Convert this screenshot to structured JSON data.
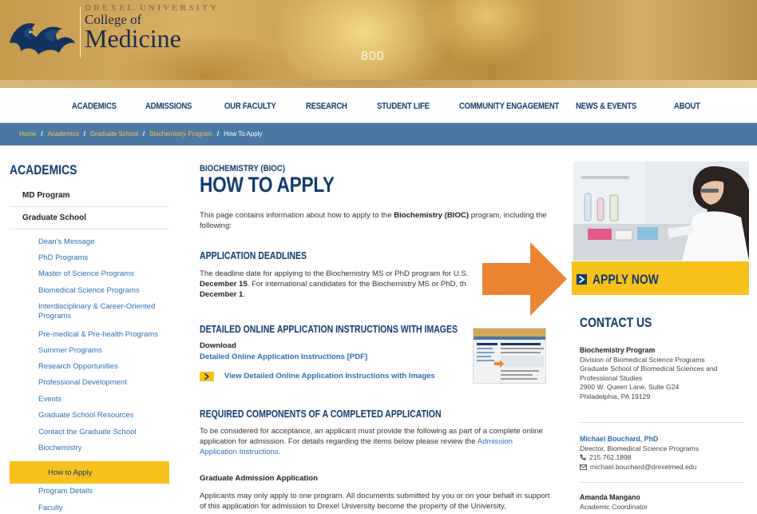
{
  "header": {
    "university": "DREXEL UNIVERSITY",
    "college_line1": "College of",
    "college_line2": "Medicine",
    "banner_mark": "800"
  },
  "nav": {
    "items": [
      "ACADEMICS",
      "ADMISSIONS",
      "OUR FACULTY",
      "RESEARCH",
      "STUDENT LIFE",
      "COMMUNITY ENGAGEMENT",
      "NEWS & EVENTS",
      "ABOUT"
    ]
  },
  "breadcrumb": {
    "items": [
      "Home",
      "Academics",
      "Graduate School",
      "Biochemistry Program",
      "How To Apply"
    ],
    "separator": "/"
  },
  "sidebar": {
    "title": "ACADEMICS",
    "top_items": [
      "MD Program",
      "Graduate School"
    ],
    "sub_items": [
      "Dean's Message",
      "PhD Programs",
      "Master of Science Programs",
      "Biomedical Science Programs",
      "Interdisciplinary & Career-Oriented Programs",
      "Pre-medical & Pre-health Programs",
      "Summer Programs",
      "Research Opportunities",
      "Professional Development",
      "Events",
      "Graduate School Resources",
      "Contact the Graduate School",
      "Biochemistry"
    ],
    "active_item": "How to Apply",
    "after_items": [
      "Program Details",
      "Faculty"
    ]
  },
  "main": {
    "eyebrow": "BIOCHEMISTRY (BIOC)",
    "title": "HOW TO APPLY",
    "intro_pre": "This page contains information about how to apply to the ",
    "intro_bold": "Biochemistry (BIOC)",
    "intro_post": " program, including the following:",
    "deadlines_heading": "APPLICATION DEADLINES",
    "deadlines_text_1": "The deadline date for applying to the Biochemistry MS or PhD program for U.S.",
    "deadlines_bold_1": "December 15",
    "deadlines_text_2": ". For international candidates for the Biochemistry MS or PhD, th",
    "deadlines_bold_2": "December 1",
    "deadlines_text_3": ".",
    "instructions_heading": "DETAILED ONLINE APPLICATION INSTRUCTIONS WITH IMAGES",
    "download_label": "Download",
    "pdf_link": "Detailed Online Application Instructions [PDF]",
    "view_link": "View Detailed Online Application Instructions with Images",
    "required_heading": "REQUIRED COMPONENTS OF A COMPLETED APPLICATION",
    "required_text": "To be considered for acceptance, an applicant must provide the following as part of a complete online application for admission. For details regarding the items below please review the ",
    "required_link": "Admission Application Instructions",
    "required_end": ".",
    "grad_app_heading": "Graduate Admission Application",
    "grad_app_text": "Applicants may only apply to one program. All documents submitted by you or on your behalf in support of this application for admission to Drexel University become the property of the University,"
  },
  "right": {
    "apply_label": "APPLY NOW",
    "contact_title": "CONTACT US",
    "contacts": [
      {
        "name": "Biochemistry Program",
        "lines": [
          "Division of Biomedical Science Programs",
          "Graduate School of Biomedical Sciences and",
          "Professional Studies",
          "2900 W. Queen Lane, Suite G24",
          "Philadelphia, PA 19129"
        ]
      },
      {
        "name": "Michael Bouchard, PhD",
        "title": "Director, Biomedical Science Programs",
        "phone": "215.762.1898",
        "email": "michael.bouchard@drexelmed.edu"
      },
      {
        "name": "Amanda Mangano",
        "title": "Academic Coordinator"
      }
    ]
  },
  "colors": {
    "navy": "#0f3d6e",
    "link_blue": "#2a6fb0",
    "gold": "#f7c11c",
    "breadcrumb_bar": "#4c79a4",
    "arrow_orange": "#ec8531"
  }
}
